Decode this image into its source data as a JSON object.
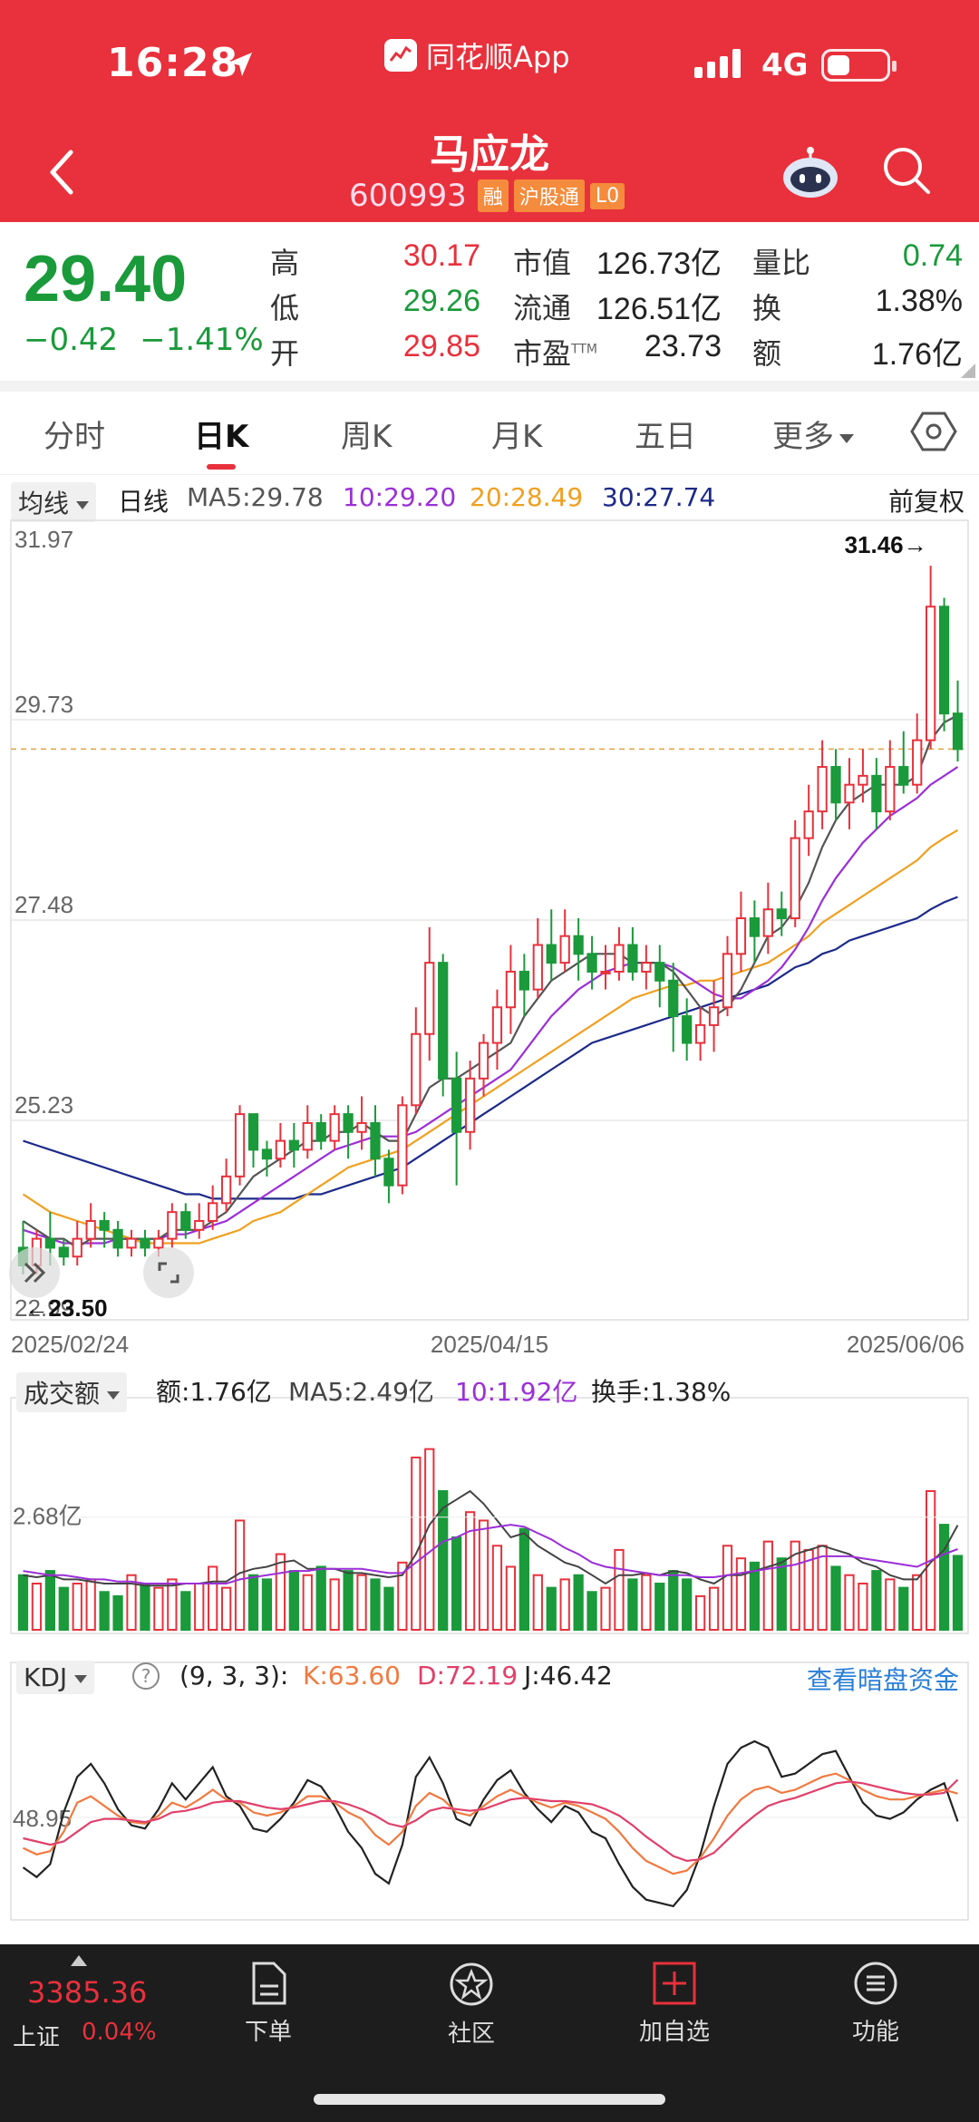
{
  "status_bar": {
    "time": "16:28",
    "app_name": "同花顺App",
    "network": "4G"
  },
  "stock": {
    "name": "马应龙",
    "code": "600993",
    "tags": [
      "融",
      "沪股通",
      "L0"
    ]
  },
  "quote": {
    "price": "29.40",
    "change": "−0.42",
    "change_pct": "−1.41%",
    "high_label": "高",
    "high": "30.17",
    "low_label": "低",
    "low": "29.26",
    "open_label": "开",
    "open": "29.85",
    "mktcap_label": "市值",
    "mktcap": "126.73亿",
    "float_label": "流通",
    "float": "126.51亿",
    "pe_label": "市盈",
    "pe_sup": "TTM",
    "pe": "23.73",
    "volratio_label": "量比",
    "volratio": "0.74",
    "turnover_label": "换",
    "turnover": "1.38%",
    "amount_label": "额",
    "amount": "1.76亿"
  },
  "tabs": [
    "分时",
    "日K",
    "周K",
    "月K",
    "五日",
    "更多"
  ],
  "active_tab": "日K",
  "ma_bar": {
    "selector": "均线",
    "period": "日线",
    "ma5": "MA5:29.78",
    "ma10": "10:29.20",
    "ma20": "20:28.49",
    "ma30": "30:27.74",
    "adjust": "前复权"
  },
  "price_axis": [
    "31.97",
    "29.73",
    "27.48",
    "25.23",
    "22.99"
  ],
  "date_axis": [
    "2025/02/24",
    "2025/04/15",
    "2025/06/06"
  ],
  "max_marker": "31.46→",
  "min_marker": "←23.50",
  "volume_bar": {
    "selector": "成交额",
    "amount": "额:1.76亿",
    "ma5": "MA5:2.49亿",
    "ma10": "10:1.92亿",
    "turnover": "换手:1.38%",
    "axis_label": "2.68亿"
  },
  "kdj_bar": {
    "selector": "KDJ",
    "help": "?",
    "params": "(9, 3, 3):",
    "k": "K:63.60",
    "d": "D:72.19",
    "j": "J:46.42",
    "link": "查看暗盘资金",
    "axis_label": "48.95"
  },
  "bottom_bar": {
    "index_value": "3385.36",
    "index_name": "上证",
    "index_pct": "0.04%",
    "nav": [
      "下单",
      "社区",
      "加自选",
      "功能"
    ]
  },
  "colors": {
    "up": "#e8313c",
    "down": "#1a9a3a",
    "ma5": "#555555",
    "ma10": "#9b2fd8",
    "ma20": "#f0a020",
    "ma30": "#1c2a8a",
    "k": "#f07a40",
    "d": "#e0406a",
    "j": "#222222",
    "vol_ma10": "#9b2fd8"
  },
  "chart_data": {
    "type": "candlestick",
    "y_range": [
      22.99,
      31.97
    ],
    "candles": [
      [
        23.8,
        23.6,
        24.1,
        23.5
      ],
      [
        23.6,
        23.9,
        24.0,
        23.5
      ],
      [
        23.9,
        23.8,
        24.2,
        23.6
      ],
      [
        23.8,
        23.7,
        23.9,
        23.6
      ],
      [
        23.7,
        23.9,
        24.1,
        23.6
      ],
      [
        23.9,
        24.1,
        24.3,
        23.8
      ],
      [
        24.1,
        24.0,
        24.2,
        23.8
      ],
      [
        24.0,
        23.8,
        24.1,
        23.7
      ],
      [
        23.8,
        23.9,
        24.0,
        23.7
      ],
      [
        23.9,
        23.8,
        24.0,
        23.7
      ],
      [
        23.8,
        23.9,
        24.0,
        23.7
      ],
      [
        23.9,
        24.2,
        24.3,
        23.8
      ],
      [
        24.2,
        24.0,
        24.3,
        23.9
      ],
      [
        24.0,
        24.1,
        24.3,
        23.9
      ],
      [
        24.1,
        24.3,
        24.5,
        24.0
      ],
      [
        24.3,
        24.6,
        24.8,
        24.2
      ],
      [
        24.6,
        25.3,
        25.4,
        24.5
      ],
      [
        25.3,
        24.9,
        25.3,
        24.7
      ],
      [
        24.9,
        24.8,
        25.0,
        24.6
      ],
      [
        24.8,
        25.0,
        25.2,
        24.7
      ],
      [
        25.0,
        24.9,
        25.2,
        24.7
      ],
      [
        24.9,
        25.2,
        25.4,
        24.8
      ],
      [
        25.2,
        25.0,
        25.3,
        24.9
      ],
      [
        25.0,
        25.3,
        25.4,
        24.9
      ],
      [
        25.3,
        25.1,
        25.4,
        24.8
      ],
      [
        25.1,
        25.2,
        25.5,
        24.9
      ],
      [
        25.2,
        24.8,
        25.4,
        24.6
      ],
      [
        24.8,
        24.5,
        24.9,
        24.3
      ],
      [
        24.5,
        25.4,
        25.5,
        24.4
      ],
      [
        25.4,
        26.2,
        26.5,
        25.3
      ],
      [
        26.2,
        27.0,
        27.4,
        25.9
      ],
      [
        27.0,
        25.7,
        27.1,
        25.5
      ],
      [
        25.7,
        25.1,
        26.0,
        24.5
      ],
      [
        25.1,
        25.7,
        25.9,
        24.9
      ],
      [
        25.7,
        26.1,
        26.2,
        25.5
      ],
      [
        26.1,
        26.5,
        26.7,
        25.8
      ],
      [
        26.5,
        26.9,
        27.2,
        26.2
      ],
      [
        26.9,
        26.7,
        27.1,
        26.4
      ],
      [
        26.7,
        27.2,
        27.5,
        26.6
      ],
      [
        27.2,
        27.0,
        27.6,
        26.8
      ],
      [
        27.0,
        27.3,
        27.6,
        26.9
      ],
      [
        27.3,
        27.1,
        27.5,
        26.8
      ],
      [
        27.1,
        26.9,
        27.3,
        26.7
      ],
      [
        26.9,
        26.9,
        27.2,
        26.7
      ],
      [
        26.9,
        27.2,
        27.4,
        26.8
      ],
      [
        27.2,
        26.9,
        27.4,
        26.8
      ],
      [
        26.9,
        27.0,
        27.2,
        26.7
      ],
      [
        27.0,
        26.8,
        27.2,
        26.5
      ],
      [
        26.8,
        26.4,
        27.0,
        26.0
      ],
      [
        26.4,
        26.1,
        26.6,
        25.9
      ],
      [
        26.1,
        26.3,
        26.5,
        25.9
      ],
      [
        26.3,
        26.5,
        26.8,
        26.0
      ],
      [
        26.5,
        27.1,
        27.3,
        26.4
      ],
      [
        27.1,
        27.5,
        27.8,
        26.9
      ],
      [
        27.5,
        27.3,
        27.7,
        27.0
      ],
      [
        27.3,
        27.6,
        27.9,
        27.1
      ],
      [
        27.6,
        27.5,
        27.8,
        27.3
      ],
      [
        27.5,
        28.4,
        28.6,
        27.4
      ],
      [
        28.4,
        28.7,
        29.0,
        28.2
      ],
      [
        28.7,
        29.2,
        29.5,
        28.5
      ],
      [
        29.2,
        28.8,
        29.4,
        28.6
      ],
      [
        28.8,
        29.0,
        29.3,
        28.5
      ],
      [
        29.0,
        29.1,
        29.4,
        28.8
      ],
      [
        29.1,
        28.7,
        29.3,
        28.5
      ],
      [
        28.7,
        29.2,
        29.5,
        28.6
      ],
      [
        29.2,
        29.0,
        29.6,
        28.9
      ],
      [
        29.0,
        29.5,
        29.8,
        28.9
      ],
      [
        29.5,
        31.0,
        31.46,
        29.4
      ],
      [
        31.0,
        29.8,
        31.1,
        29.6
      ],
      [
        29.8,
        29.4,
        30.17,
        29.26
      ]
    ],
    "ma5": [
      24.1,
      24.0,
      23.9,
      23.9,
      23.8,
      23.9,
      23.9,
      23.9,
      23.9,
      23.9,
      23.9,
      24.0,
      24.0,
      24.0,
      24.1,
      24.2,
      24.4,
      24.6,
      24.7,
      24.8,
      24.9,
      25.0,
      25.0,
      25.1,
      25.1,
      25.2,
      25.1,
      25.0,
      25.0,
      25.3,
      25.6,
      25.7,
      25.7,
      25.8,
      25.9,
      26.0,
      26.1,
      26.4,
      26.6,
      26.8,
      26.9,
      27.0,
      27.1,
      27.1,
      27.1,
      27.0,
      27.0,
      27.0,
      26.9,
      26.7,
      26.5,
      26.4,
      26.5,
      26.7,
      27.0,
      27.3,
      27.4,
      27.6,
      27.9,
      28.3,
      28.6,
      28.8,
      28.9,
      29.0,
      29.0,
      29.0,
      29.1,
      29.5,
      29.7,
      29.78
    ],
    "ma10": [
      24.0,
      23.95,
      23.9,
      23.85,
      23.85,
      23.85,
      23.85,
      23.9,
      23.9,
      23.9,
      23.9,
      23.95,
      23.95,
      24.0,
      24.05,
      24.1,
      24.2,
      24.3,
      24.4,
      24.5,
      24.6,
      24.7,
      24.8,
      24.9,
      24.95,
      25.0,
      25.05,
      25.05,
      25.05,
      25.1,
      25.2,
      25.3,
      25.4,
      25.5,
      25.6,
      25.7,
      25.8,
      26.0,
      26.2,
      26.4,
      26.55,
      26.7,
      26.8,
      26.9,
      26.95,
      27.0,
      27.0,
      27.0,
      26.95,
      26.85,
      26.75,
      26.65,
      26.6,
      26.6,
      26.7,
      26.8,
      26.95,
      27.15,
      27.4,
      27.7,
      27.95,
      28.15,
      28.35,
      28.5,
      28.65,
      28.75,
      28.85,
      29.0,
      29.1,
      29.2
    ],
    "ma20": [
      24.4,
      24.3,
      24.2,
      24.15,
      24.1,
      24.05,
      24.0,
      23.95,
      23.9,
      23.85,
      23.85,
      23.85,
      23.85,
      23.85,
      23.9,
      23.95,
      24.0,
      24.1,
      24.15,
      24.2,
      24.3,
      24.4,
      24.5,
      24.6,
      24.7,
      24.75,
      24.8,
      24.85,
      24.9,
      25.0,
      25.1,
      25.2,
      25.3,
      25.4,
      25.5,
      25.6,
      25.7,
      25.8,
      25.9,
      26.0,
      26.1,
      26.2,
      26.3,
      26.4,
      26.5,
      26.6,
      26.65,
      26.7,
      26.75,
      26.75,
      26.8,
      26.8,
      26.85,
      26.9,
      26.95,
      27.0,
      27.1,
      27.2,
      27.3,
      27.45,
      27.55,
      27.65,
      27.75,
      27.85,
      27.95,
      28.05,
      28.15,
      28.3,
      28.4,
      28.49
    ],
    "ma30": [
      25.0,
      24.95,
      24.9,
      24.85,
      24.8,
      24.75,
      24.7,
      24.65,
      24.6,
      24.55,
      24.5,
      24.45,
      24.4,
      24.4,
      24.35,
      24.35,
      24.35,
      24.35,
      24.35,
      24.35,
      24.35,
      24.4,
      24.4,
      24.45,
      24.5,
      24.55,
      24.6,
      24.65,
      24.7,
      24.8,
      24.9,
      25.0,
      25.1,
      25.2,
      25.3,
      25.4,
      25.5,
      25.6,
      25.7,
      25.8,
      25.9,
      26.0,
      26.1,
      26.15,
      26.2,
      26.25,
      26.3,
      26.35,
      26.4,
      26.45,
      26.5,
      26.55,
      26.6,
      26.65,
      26.7,
      26.75,
      26.85,
      26.95,
      27.0,
      27.1,
      27.15,
      27.25,
      27.3,
      27.35,
      27.4,
      27.45,
      27.5,
      27.6,
      27.68,
      27.74
    ],
    "volume": [
      1.3,
      1.1,
      1.4,
      1.0,
      1.1,
      1.2,
      0.9,
      0.8,
      1.3,
      1.1,
      1.0,
      1.2,
      0.9,
      1.1,
      1.5,
      1.0,
      2.6,
      1.3,
      1.2,
      1.8,
      1.4,
      1.3,
      1.5,
      1.2,
      1.4,
      1.3,
      1.2,
      1.0,
      1.6,
      4.1,
      4.3,
      3.3,
      2.2,
      2.8,
      2.6,
      2.0,
      1.5,
      2.4,
      1.3,
      1.0,
      1.2,
      1.3,
      0.9,
      1.0,
      1.9,
      1.2,
      1.3,
      1.1,
      1.4,
      1.2,
      0.8,
      1.0,
      2.0,
      1.7,
      1.6,
      2.1,
      1.7,
      2.1,
      1.9,
      2.0,
      1.5,
      1.3,
      1.1,
      1.4,
      1.2,
      1.0,
      1.3,
      3.3,
      2.5,
      1.76
    ],
    "vol_ma5": [
      1.3,
      1.25,
      1.3,
      1.2,
      1.2,
      1.15,
      1.1,
      1.1,
      1.1,
      1.05,
      1.05,
      1.05,
      1.1,
      1.1,
      1.15,
      1.15,
      1.35,
      1.45,
      1.5,
      1.6,
      1.65,
      1.45,
      1.45,
      1.45,
      1.35,
      1.35,
      1.3,
      1.25,
      1.3,
      1.8,
      2.5,
      2.9,
      3.1,
      3.3,
      3.0,
      2.6,
      2.2,
      2.3,
      2.0,
      1.8,
      1.6,
      1.5,
      1.3,
      1.1,
      1.3,
      1.3,
      1.35,
      1.3,
      1.4,
      1.35,
      1.2,
      1.1,
      1.3,
      1.3,
      1.4,
      1.5,
      1.6,
      1.8,
      1.9,
      2.0,
      1.9,
      1.8,
      1.6,
      1.5,
      1.3,
      1.2,
      1.2,
      1.6,
      1.9,
      2.49
    ],
    "vol_ma10": [
      1.4,
      1.35,
      1.3,
      1.3,
      1.25,
      1.2,
      1.2,
      1.15,
      1.15,
      1.1,
      1.1,
      1.1,
      1.1,
      1.1,
      1.1,
      1.1,
      1.2,
      1.25,
      1.3,
      1.35,
      1.4,
      1.4,
      1.45,
      1.45,
      1.45,
      1.45,
      1.4,
      1.35,
      1.35,
      1.6,
      1.85,
      2.1,
      2.2,
      2.35,
      2.4,
      2.45,
      2.5,
      2.45,
      2.3,
      2.15,
      1.95,
      1.8,
      1.6,
      1.5,
      1.45,
      1.4,
      1.35,
      1.3,
      1.3,
      1.3,
      1.25,
      1.25,
      1.3,
      1.35,
      1.4,
      1.45,
      1.5,
      1.55,
      1.65,
      1.75,
      1.75,
      1.75,
      1.7,
      1.65,
      1.6,
      1.55,
      1.5,
      1.65,
      1.8,
      1.92
    ],
    "vol_range": [
      0,
      4.4
    ],
    "k": [
      30,
      26,
      28,
      40,
      58,
      62,
      56,
      50,
      46,
      45,
      50,
      58,
      55,
      60,
      66,
      60,
      58,
      52,
      50,
      52,
      56,
      62,
      62,
      58,
      52,
      48,
      38,
      32,
      40,
      56,
      64,
      60,
      52,
      50,
      56,
      62,
      66,
      62,
      58,
      55,
      58,
      56,
      52,
      48,
      40,
      30,
      22,
      18,
      14,
      16,
      24,
      36,
      50,
      60,
      66,
      68,
      64,
      66,
      70,
      74,
      76,
      72,
      66,
      62,
      60,
      60,
      62,
      64,
      66,
      63.6
    ],
    "d": [
      36,
      34,
      32,
      34,
      40,
      46,
      48,
      48,
      47,
      46,
      48,
      52,
      53,
      55,
      58,
      59,
      59,
      57,
      55,
      54,
      55,
      57,
      59,
      59,
      57,
      54,
      50,
      45,
      43,
      47,
      53,
      55,
      54,
      53,
      54,
      57,
      60,
      61,
      60,
      59,
      59,
      58,
      57,
      54,
      50,
      44,
      37,
      31,
      25,
      22,
      23,
      27,
      35,
      43,
      50,
      56,
      59,
      61,
      64,
      67,
      70,
      71,
      70,
      68,
      66,
      64,
      63,
      63,
      64,
      72.19
    ],
    "j": [
      18,
      12,
      20,
      52,
      74,
      82,
      70,
      54,
      44,
      42,
      54,
      70,
      60,
      70,
      80,
      62,
      56,
      42,
      40,
      48,
      58,
      72,
      68,
      56,
      40,
      30,
      14,
      8,
      32,
      74,
      86,
      70,
      48,
      44,
      60,
      72,
      78,
      64,
      54,
      46,
      56,
      52,
      40,
      36,
      20,
      6,
      -2,
      -4,
      -6,
      4,
      26,
      56,
      82,
      92,
      96,
      92,
      74,
      76,
      82,
      88,
      90,
      74,
      58,
      50,
      48,
      52,
      60,
      66,
      70,
      46.42
    ],
    "kdj_range": [
      -10,
      110
    ]
  }
}
